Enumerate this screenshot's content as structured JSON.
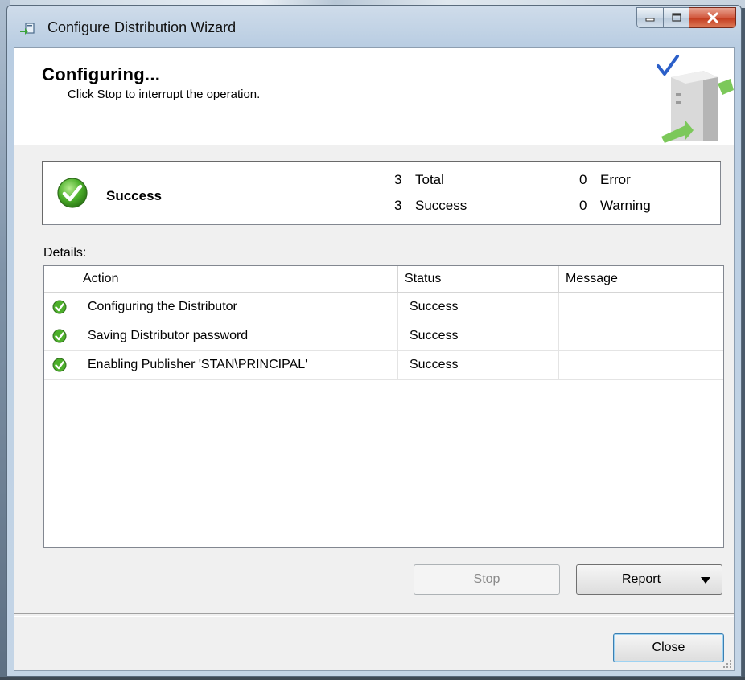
{
  "window": {
    "title": "Configure Distribution Wizard",
    "icon": "wizard-icon"
  },
  "header": {
    "title": "Configuring...",
    "subtitle": "Click Stop to interrupt the operation.",
    "graphic": "server-check-graphic"
  },
  "summary": {
    "status": "Success",
    "total_count": "3",
    "total_label": "Total",
    "success_count": "3",
    "success_label": "Success",
    "error_count": "0",
    "error_label": "Error",
    "warning_count": "0",
    "warning_label": "Warning"
  },
  "details": {
    "label": "Details:",
    "columns": [
      "Action",
      "Status",
      "Message"
    ],
    "rows": [
      {
        "action": "Configuring the Distributor",
        "status": "Success",
        "message": ""
      },
      {
        "action": "Saving Distributor password",
        "status": "Success",
        "message": ""
      },
      {
        "action": "Enabling Publisher 'STAN\\PRINCIPAL'",
        "status": "Success",
        "message": ""
      }
    ]
  },
  "buttons": {
    "stop": "Stop",
    "report": "Report",
    "close": "Close"
  },
  "colors": {
    "success_green": "#4caf2a",
    "titlebar_close": "#c7421f"
  }
}
